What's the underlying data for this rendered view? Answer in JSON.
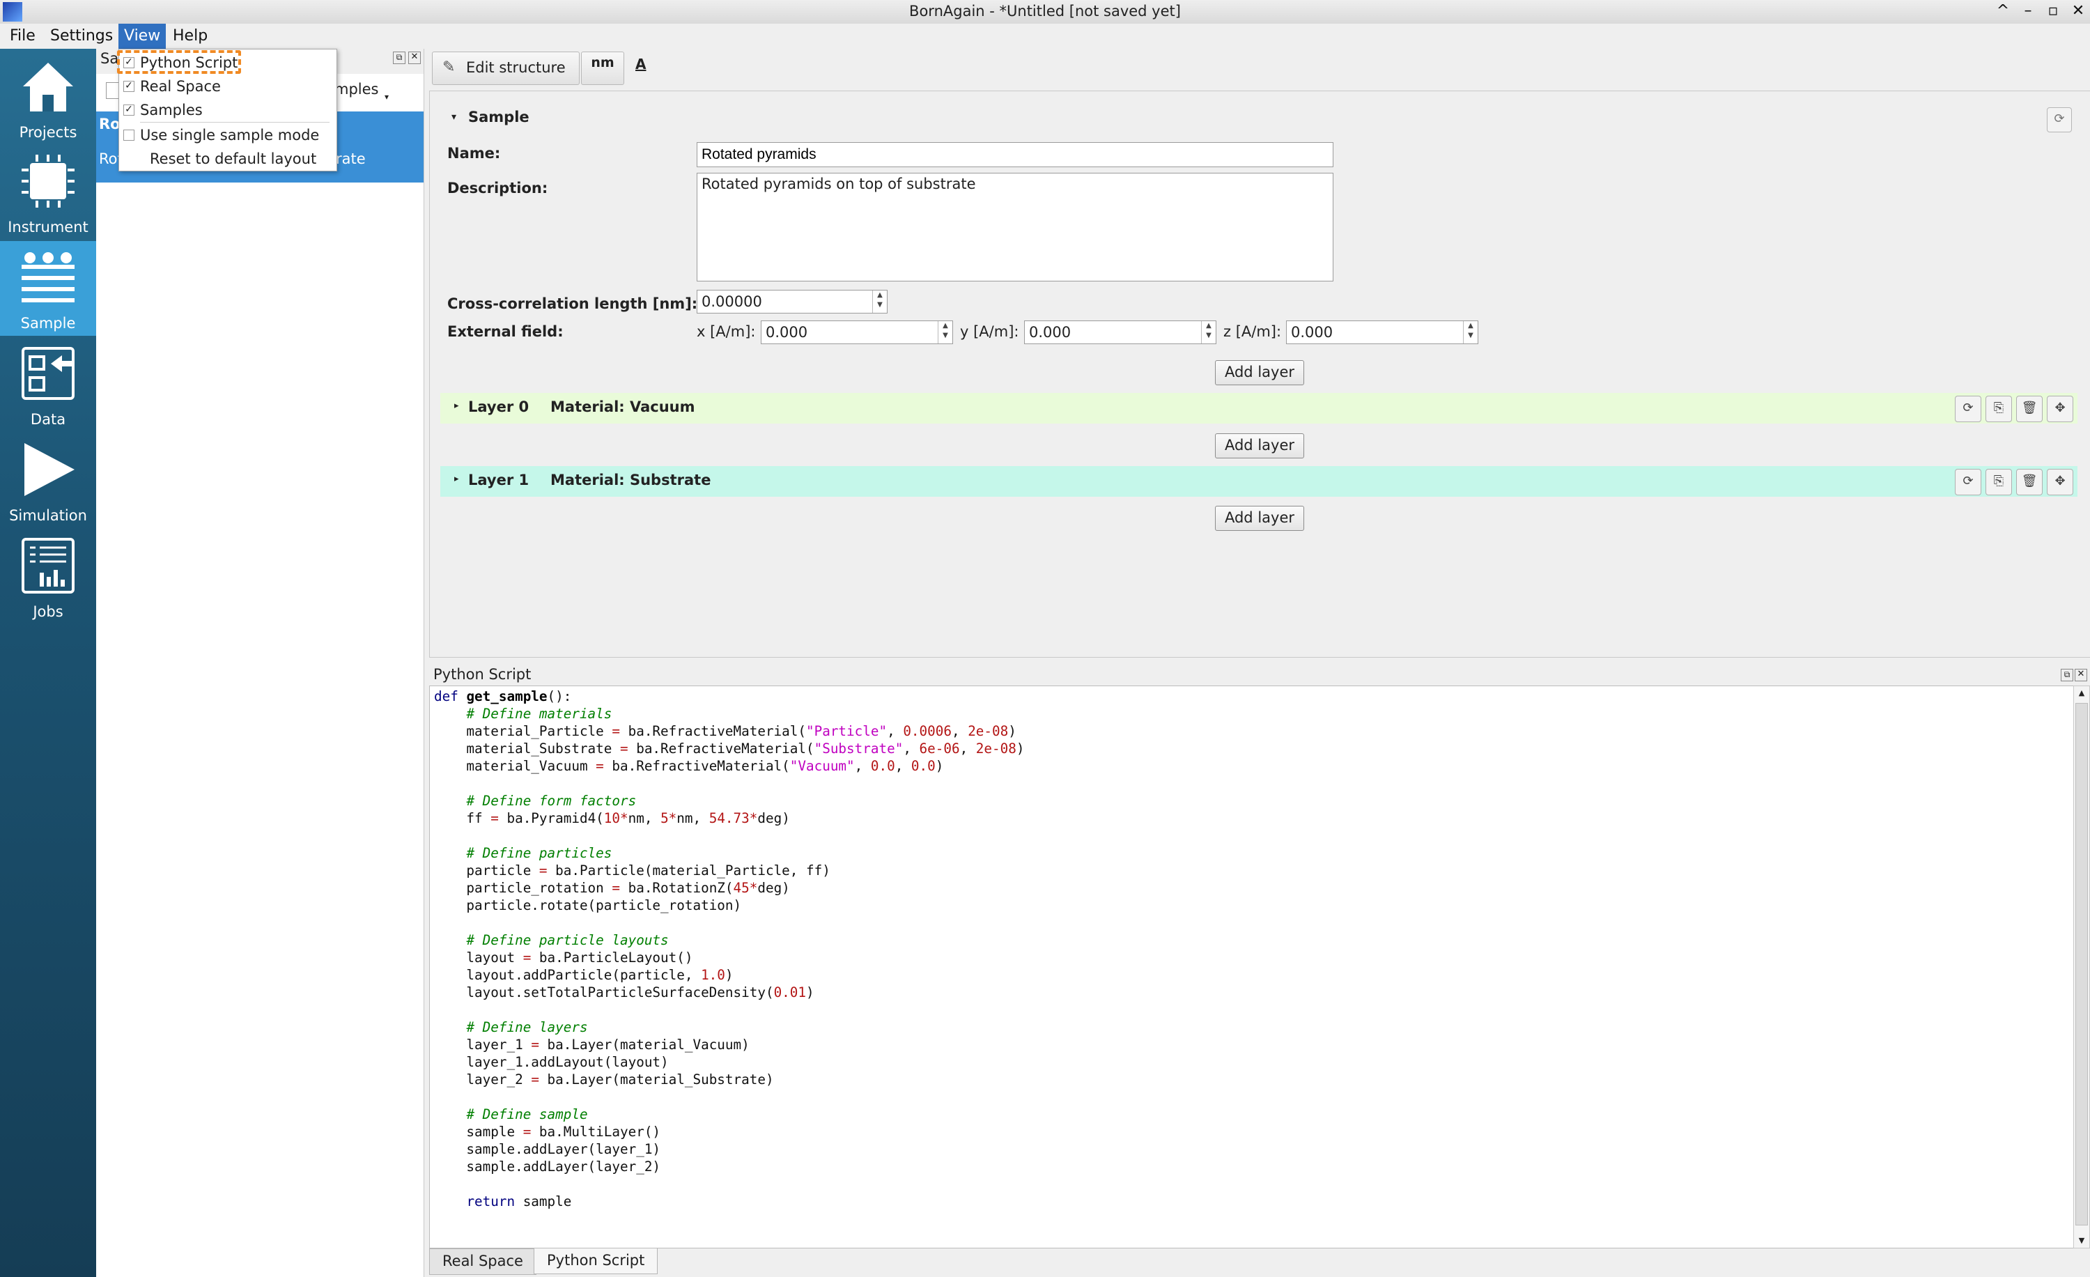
{
  "window": {
    "title": "BornAgain - *Untitled [not saved yet]",
    "controls": [
      "^",
      "–",
      "▫",
      "✕"
    ]
  },
  "menubar": {
    "file": "File",
    "settings": "Settings",
    "view": "View",
    "help": "Help"
  },
  "sidebar": {
    "items": [
      {
        "label": "Projects",
        "icon": "home-icon"
      },
      {
        "label": "Instrument",
        "icon": "chip-icon"
      },
      {
        "label": "Sample",
        "icon": "sample-layers-icon"
      },
      {
        "label": "Data",
        "icon": "import-data-icon"
      },
      {
        "label": "Simulation",
        "icon": "play-icon"
      },
      {
        "label": "Jobs",
        "icon": "jobs-chart-icon"
      }
    ],
    "active": "Sample"
  },
  "samples_dock": {
    "title_fragment": "Sa",
    "examples_fragment": "mples",
    "selected_fragment_1": "Ro",
    "selected_fragment_2": "Rot",
    "selected_fragment_3": "rate"
  },
  "view_menu": {
    "items": [
      {
        "label": "Python Script",
        "checked": true
      },
      {
        "label": "Real Space",
        "checked": true
      },
      {
        "label": "Samples",
        "checked": true
      },
      {
        "label": "Use single sample mode",
        "checked": false
      },
      {
        "label": "Reset to default layout",
        "checked": null
      }
    ]
  },
  "toolbar": {
    "edit_structure": "Edit structure",
    "unit_nm": "nm",
    "font_a": "A"
  },
  "sample_form": {
    "section": "Sample",
    "name_label": "Name:",
    "name_value": "Rotated pyramids",
    "description_label": "Description:",
    "description_value": "Rotated pyramids on top of substrate",
    "cross_corr_label": "Cross-correlation length [nm]:",
    "cross_corr_value": "0.00000",
    "external_field_label": "External field:",
    "x_label": "x [A/m]:",
    "x_value": "0.000",
    "y_label": "y [A/m]:",
    "y_value": "0.000",
    "z_label": "z [A/m]:",
    "z_value": "0.000",
    "add_layer": "Add layer"
  },
  "layers": [
    {
      "name": "Layer 0",
      "material": "Material: Vacuum",
      "color": "#e9fbd9"
    },
    {
      "name": "Layer 1",
      "material": "Material: Substrate",
      "color": "#c5f7ea"
    }
  ],
  "python_dock": {
    "title": "Python Script"
  },
  "bottom_tabs": {
    "real_space": "Real Space",
    "python_script": "Python Script"
  },
  "colors": {
    "sidebar_active": "#3aa0d8",
    "menu_highlight": "#3070c0",
    "annotation": "#f08a24"
  }
}
